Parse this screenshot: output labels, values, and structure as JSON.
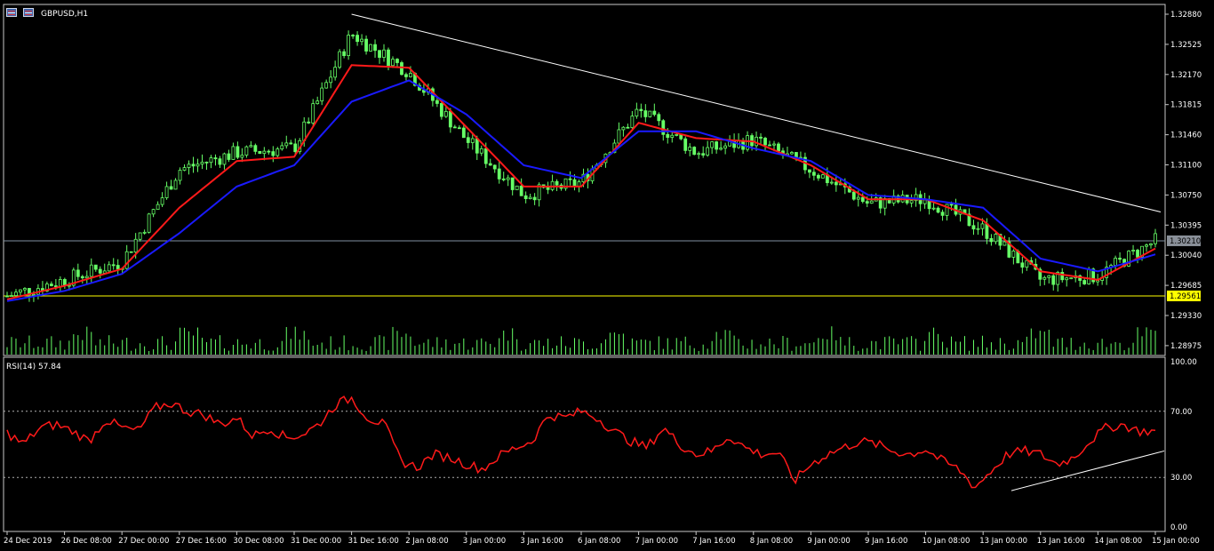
{
  "window": {
    "symbol_title": "GBPUSD,H1",
    "icons": [
      "chart-window-icon",
      "chart-properties-icon"
    ]
  },
  "price_axis": {
    "labels": [
      "1.32880",
      "1.32525",
      "1.32170",
      "1.31815",
      "1.31460",
      "1.31100",
      "1.30750",
      "1.30395",
      "1.30040",
      "1.29685",
      "1.29330",
      "1.28975"
    ],
    "values": [
      1.3288,
      1.32525,
      1.3217,
      1.31815,
      1.3146,
      1.311,
      1.3075,
      1.30395,
      1.3004,
      1.29685,
      1.2933,
      1.28975
    ],
    "current_price_label": "1.30210",
    "support_price_label": "1.29561"
  },
  "rsi": {
    "title": "RSI(14) 57.84",
    "axis_labels": [
      "100.00",
      "70.00",
      "30.00",
      "0.00"
    ],
    "levels": [
      70,
      30
    ],
    "color": "#ff1a1a"
  },
  "time_axis": {
    "labels": [
      "24 Dec 2019",
      "26 Dec 08:00",
      "27 Dec 00:00",
      "27 Dec 16:00",
      "30 Dec 08:00",
      "31 Dec 00:00",
      "31 Dec 16:00",
      "2 Jan 08:00",
      "3 Jan 00:00",
      "3 Jan 16:00",
      "6 Jan 08:00",
      "7 Jan 00:00",
      "7 Jan 16:00",
      "8 Jan 08:00",
      "9 Jan 00:00",
      "9 Jan 16:00",
      "10 Jan 08:00",
      "13 Jan 00:00",
      "13 Jan 16:00",
      "14 Jan 08:00",
      "15 Jan 00:00"
    ]
  },
  "colors": {
    "background": "#000000",
    "candles": "#66ff66",
    "ma_fast": "#ff1a1a",
    "ma_slow": "#1a1aff",
    "trendline": "#ffffff",
    "support_line": "#ffff00",
    "current_price_line": "#8090a0",
    "support_tag_bg": "#ffff00",
    "current_tag_bg": "#8a9099"
  },
  "chart_data": [
    {
      "type": "candlestick",
      "symbol": "GBPUSD",
      "timeframe": "H1",
      "ylim": [
        1.287,
        1.329
      ],
      "close_path": [
        [
          "24 Dec 2019",
          1.2956
        ],
        [
          "26 Dec 08:00",
          1.2975
        ],
        [
          "27 Dec 00:00",
          1.2996
        ],
        [
          "27 Dec 16:00",
          1.3105
        ],
        [
          "30 Dec 08:00",
          1.3125
        ],
        [
          "31 Dec 00:00",
          1.313
        ],
        [
          "31 Dec 16:00",
          1.3265
        ],
        [
          "2 Jan 08:00",
          1.322
        ],
        [
          "3 Jan 00:00",
          1.314
        ],
        [
          "3 Jan 16:00",
          1.3075
        ],
        [
          "6 Jan 08:00",
          1.309
        ],
        [
          "7 Jan 00:00",
          1.3175
        ],
        [
          "7 Jan 16:00",
          1.3125
        ],
        [
          "8 Jan 08:00",
          1.314
        ],
        [
          "9 Jan 00:00",
          1.3105
        ],
        [
          "9 Jan 16:00",
          1.3065
        ],
        [
          "10 Jan 08:00",
          1.307
        ],
        [
          "13 Jan 00:00",
          1.3035
        ],
        [
          "13 Jan 16:00",
          1.2975
        ],
        [
          "14 Jan 08:00",
          1.298
        ],
        [
          "15 Jan 00:00",
          1.3021
        ]
      ],
      "moving_averages": [
        {
          "name": "fast",
          "color": "#ff1a1a",
          "values": [
            1.2952,
            1.2968,
            1.2988,
            1.306,
            1.3115,
            1.312,
            1.3228,
            1.3225,
            1.3155,
            1.3085,
            1.3085,
            1.316,
            1.3142,
            1.3138,
            1.311,
            1.307,
            1.307,
            1.3045,
            1.2985,
            1.2975,
            1.3012
          ]
        },
        {
          "name": "slow",
          "color": "#1a1aff",
          "values": [
            1.295,
            1.2962,
            1.2982,
            1.303,
            1.3085,
            1.311,
            1.3185,
            1.321,
            1.317,
            1.311,
            1.3095,
            1.315,
            1.315,
            1.313,
            1.3115,
            1.3075,
            1.307,
            1.306,
            1.3,
            1.2985,
            1.3005
          ]
        }
      ],
      "trendline": {
        "from": [
          "31 Dec 16:00",
          1.3288
        ],
        "to": [
          "15 Jan 00:00",
          1.3055
        ]
      },
      "horizontal_lines": [
        {
          "label": "1.30210",
          "value": 1.3021
        },
        {
          "label": "1.29561",
          "value": 1.29561
        }
      ],
      "last_price": 1.3021
    },
    {
      "type": "line",
      "title": "RSI(14) 57.84",
      "ylim": [
        0,
        100
      ],
      "levels": [
        70,
        30
      ],
      "values": [
        57,
        50,
        60,
        62,
        58,
        52,
        65,
        60,
        58,
        72,
        75,
        70,
        68,
        62,
        66,
        55,
        60,
        54,
        56,
        62,
        74,
        78,
        66,
        62,
        40,
        36,
        44,
        42,
        38,
        35,
        43,
        48,
        52,
        68,
        66,
        70,
        66,
        58,
        52,
        48,
        60,
        50,
        44,
        46,
        55,
        48,
        44,
        45,
        28,
        38,
        44,
        48,
        52,
        50,
        46,
        44,
        47,
        40,
        35,
        24,
        34,
        44,
        46,
        44,
        38,
        42,
        52,
        60,
        62,
        58,
        57.84
      ],
      "trendline": {
        "from_value": 22,
        "to_value": 46
      }
    }
  ]
}
